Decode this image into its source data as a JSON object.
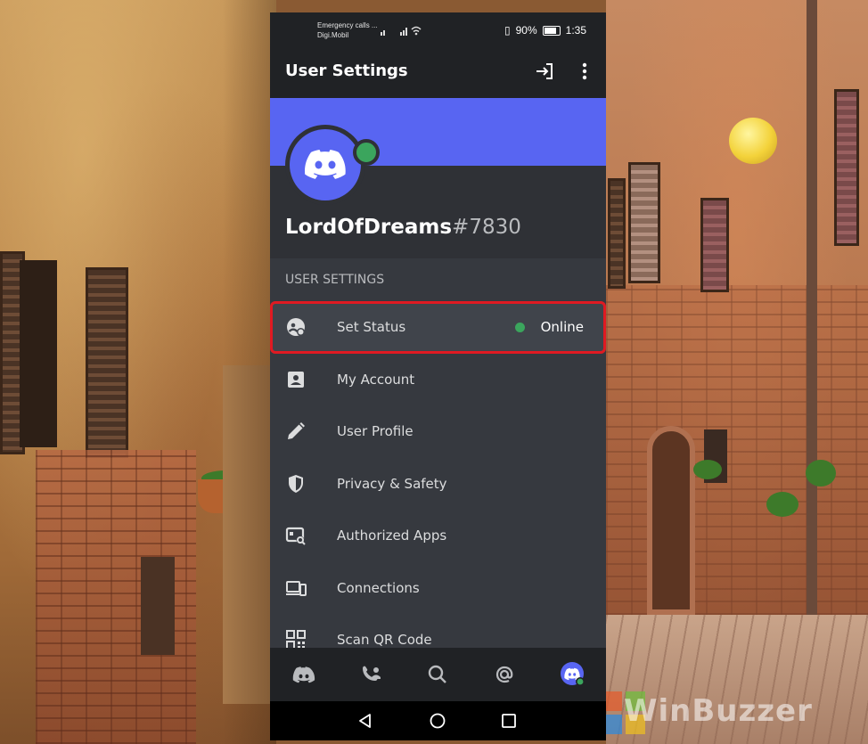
{
  "status_bar": {
    "carrier_line1": "Emergency calls ...",
    "carrier_line2": "Digi.Mobil",
    "battery": "90%",
    "time": "1:35"
  },
  "header": {
    "title": "User Settings",
    "logout_icon": "logout-icon",
    "more_icon": "kebab-menu-icon"
  },
  "profile": {
    "username": "LordOfDreams",
    "discriminator": "#7830",
    "status_color": "#3ba55d",
    "banner_color": "#5865f2"
  },
  "section": {
    "title": "USER SETTINGS"
  },
  "menu": [
    {
      "label": "Set Status",
      "icon": "status-icon",
      "value": "Online"
    },
    {
      "label": "My Account",
      "icon": "account-icon"
    },
    {
      "label": "User Profile",
      "icon": "pencil-icon"
    },
    {
      "label": "Privacy & Safety",
      "icon": "shield-icon"
    },
    {
      "label": "Authorized Apps",
      "icon": "apps-icon"
    },
    {
      "label": "Connections",
      "icon": "devices-icon"
    },
    {
      "label": "Scan QR Code",
      "icon": "qr-code-icon"
    }
  ],
  "bottom_nav": [
    "discord-home-icon",
    "friends-icon",
    "search-icon",
    "mentions-icon",
    "profile-avatar-icon"
  ],
  "system_nav": [
    "back-icon",
    "home-icon",
    "recents-icon"
  ],
  "watermark": "WinBuzzer",
  "colors": {
    "highlight_border": "#e01a22",
    "background": "#36393f",
    "surface_dark": "#202225"
  }
}
